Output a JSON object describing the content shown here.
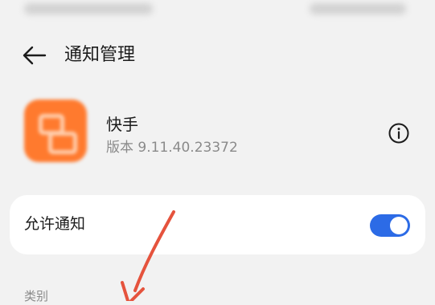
{
  "header": {
    "title": "通知管理",
    "back_icon": "back-arrow-icon"
  },
  "app": {
    "name": "快手",
    "version": "版本 9.11.40.23372",
    "icon_color": "#ff7a2e",
    "info_icon": "info-icon"
  },
  "settings": {
    "allow_notifications_label": "允许通知",
    "allow_notifications_on": true,
    "accent_color": "#2c6be6"
  },
  "section": {
    "category_label": "类别"
  },
  "annotation": {
    "arrow_color": "#e5533d"
  }
}
